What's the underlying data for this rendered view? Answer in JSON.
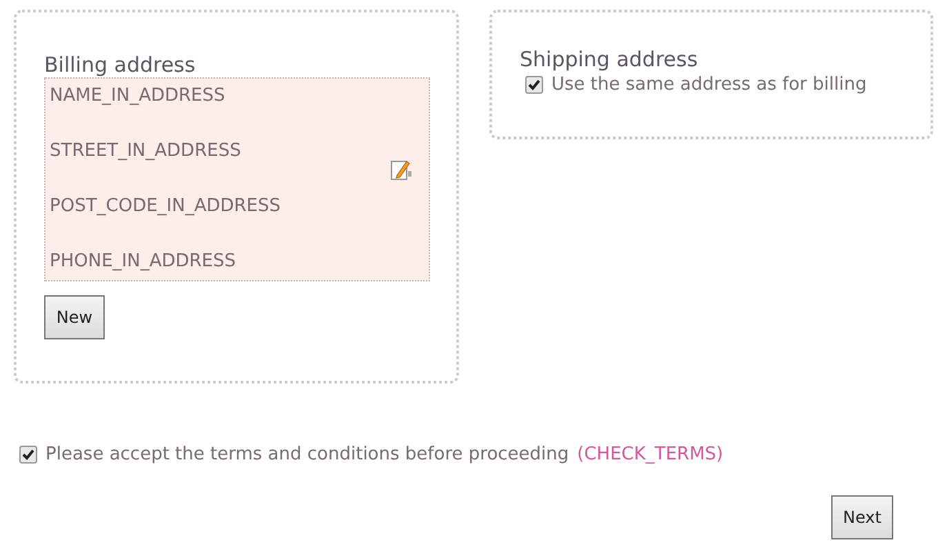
{
  "billing": {
    "title": "Billing address",
    "address_lines": [
      "NAME_IN_ADDRESS",
      "STREET_IN_ADDRESS",
      "POST_CODE_IN_ADDRESS",
      "PHONE_IN_ADDRESS"
    ],
    "new_button": "New"
  },
  "shipping": {
    "title": "Shipping address",
    "same_as_billing": {
      "label": "Use the same address as for billing",
      "checked": true
    }
  },
  "terms": {
    "label": "Please accept the terms and conditions before proceeding",
    "error": "(CHECK_TERMS)",
    "checked": true
  },
  "next_button": "Next"
}
